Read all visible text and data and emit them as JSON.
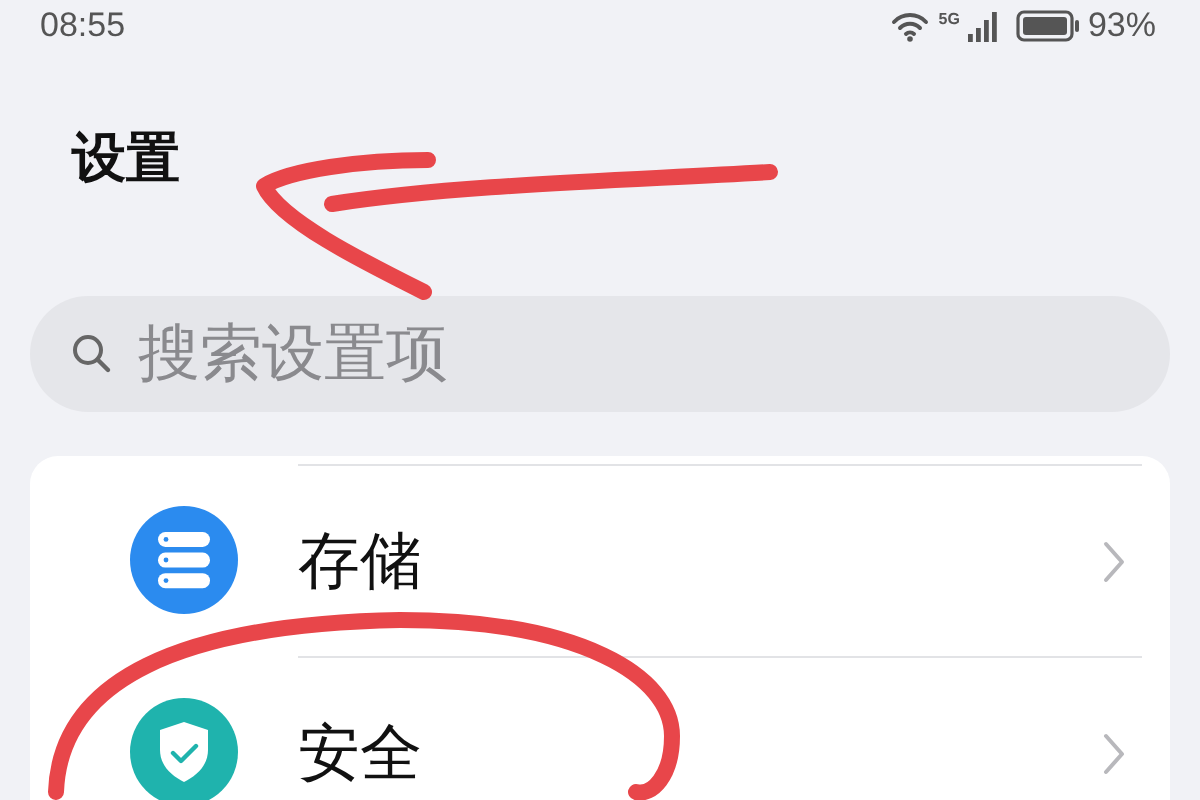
{
  "status_bar": {
    "time": "08:55",
    "network": "5G",
    "battery": "93%"
  },
  "title": "设置",
  "search": {
    "placeholder": "搜索设置项"
  },
  "items": [
    {
      "label": "存储",
      "kind": "storage"
    },
    {
      "label": "安全",
      "kind": "security"
    }
  ],
  "annotations": {
    "arrow": {
      "color": "#e8464a"
    },
    "ellipse": {
      "color": "#e8464a"
    }
  }
}
